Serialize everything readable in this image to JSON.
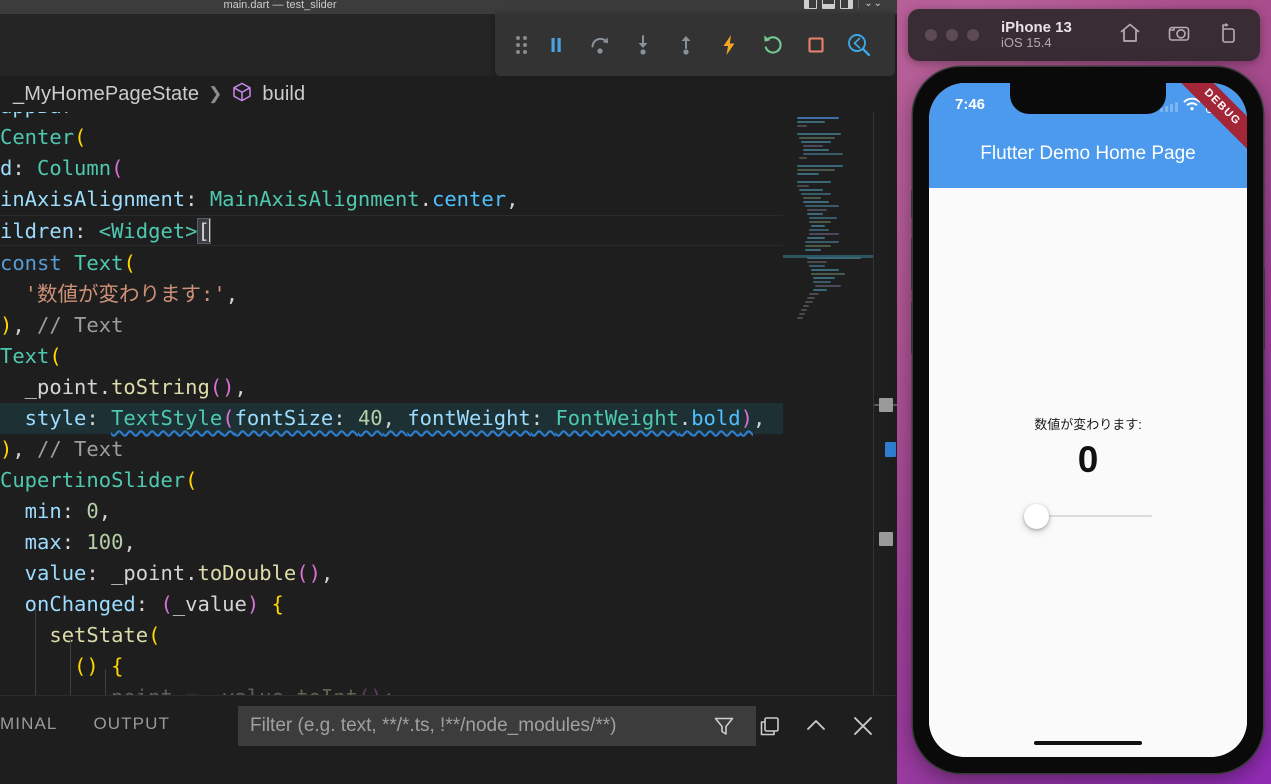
{
  "window": {
    "title": "main.dart — test_slider",
    "titlebar_actions": [
      {
        "name": "toggle-primary-sidebar",
        "icon": "panel-left-icon"
      },
      {
        "name": "toggle-panel",
        "icon": "panel-bottom-icon"
      },
      {
        "name": "toggle-secondary-sidebar",
        "icon": "panel-right-icon"
      },
      {
        "name": "customize-layout",
        "icon": "layout-icon",
        "label": "⌄⌄"
      }
    ]
  },
  "debug_toolbar": {
    "buttons": [
      {
        "name": "drag-handle",
        "icon": "grip-dots-icon",
        "tooltip": "Drag",
        "color": "#8b8b8b"
      },
      {
        "name": "pause-button",
        "icon": "pause-icon",
        "tooltip": "Pause",
        "color": "#4aa3e0"
      },
      {
        "name": "step-over-button",
        "icon": "step-over-icon",
        "tooltip": "Step Over",
        "color": "#8a9299"
      },
      {
        "name": "step-into-button",
        "icon": "step-into-icon",
        "tooltip": "Step Into",
        "color": "#8a9299"
      },
      {
        "name": "step-out-button",
        "icon": "step-out-icon",
        "tooltip": "Step Out",
        "color": "#8a9299"
      },
      {
        "name": "hot-reload-button",
        "icon": "lightning-icon",
        "tooltip": "Hot Reload",
        "color": "#f5a623"
      },
      {
        "name": "hot-restart-button",
        "icon": "restart-icon",
        "tooltip": "Hot Restart",
        "color": "#73c991"
      },
      {
        "name": "stop-button",
        "icon": "stop-square-icon",
        "tooltip": "Stop",
        "color": "#e8836b"
      },
      {
        "name": "inspector-button",
        "icon": "flutter-inspector-icon",
        "tooltip": "Open Flutter Inspector",
        "color": "#3da8e8"
      }
    ]
  },
  "breadcrumb": {
    "items": [
      {
        "label": "_MyHomePageState",
        "icon": "class-icon"
      },
      {
        "label": "build",
        "icon": "method-cube-icon"
      }
    ],
    "separator": "❯"
  },
  "editor": {
    "language": "dart",
    "cursor_token": "[",
    "lines": [
      {
        "indent": 0,
        "text": "appBar",
        "clipped_top": true
      },
      {
        "indent": 0,
        "text": "Center("
      },
      {
        "indent": 0,
        "text": "d: Column("
      },
      {
        "indent": 0,
        "text": "inAxisAlignment: MainAxisAlignment.center,"
      },
      {
        "indent": 0,
        "text": "ildren: <Widget>["
      },
      {
        "indent": 0,
        "text": "const Text("
      },
      {
        "indent": 0,
        "text": "  '数値が変わります:',"
      },
      {
        "indent": 0,
        "text": "), // Text"
      },
      {
        "indent": 0,
        "text": "Text("
      },
      {
        "indent": 0,
        "text": "  _point.toString(),"
      },
      {
        "indent": 0,
        "text": "  style: TextStyle(fontSize: 40, fontWeight: FontWeight.bold),",
        "highlighted": true
      },
      {
        "indent": 0,
        "text": "), // Text"
      },
      {
        "indent": 0,
        "text": "CupertinoSlider("
      },
      {
        "indent": 0,
        "text": "  min: 0,"
      },
      {
        "indent": 0,
        "text": "  max: 100,"
      },
      {
        "indent": 0,
        "text": "  value: _point.toDouble(),"
      },
      {
        "indent": 0,
        "text": "  onChanged: (_value) {"
      },
      {
        "indent": 0,
        "text": "    setState("
      },
      {
        "indent": 0,
        "text": "      () {"
      },
      {
        "indent": 0,
        "text": "        _point = _value.toInt();",
        "clipped_bottom": true
      }
    ]
  },
  "panel": {
    "tabs": [
      {
        "label": "MINAL",
        "active": false,
        "name": "tab-terminal"
      },
      {
        "label": "OUTPUT",
        "active": false,
        "name": "tab-output"
      }
    ],
    "filter_placeholder": "Filter (e.g. text, **/*.ts, !**/node_modules/**)",
    "filter_value": "",
    "actions": [
      {
        "name": "filter-icon",
        "label": "filter"
      },
      {
        "name": "split-panel-icon",
        "label": "split"
      },
      {
        "name": "maximize-panel-icon",
        "label": "maximize"
      },
      {
        "name": "close-panel-icon",
        "label": "close"
      }
    ]
  },
  "simulator": {
    "device_name": "iPhone 13",
    "os_version": "iOS 15.4",
    "toolbar_icons": [
      {
        "name": "home-icon"
      },
      {
        "name": "screenshot-camera-icon"
      },
      {
        "name": "rotate-device-icon"
      }
    ],
    "status_bar": {
      "time": "7:46",
      "wifi": "wifi-icon",
      "battery": "battery-full-icon"
    },
    "debug_banner": "DEBUG",
    "app": {
      "appbar_title": "Flutter Demo Home Page",
      "appbar_color": "#4c9aed",
      "label": "数値が変わります:",
      "value": "0",
      "slider": {
        "min": 0,
        "max": 100,
        "value": 0,
        "percent": 0
      }
    }
  }
}
